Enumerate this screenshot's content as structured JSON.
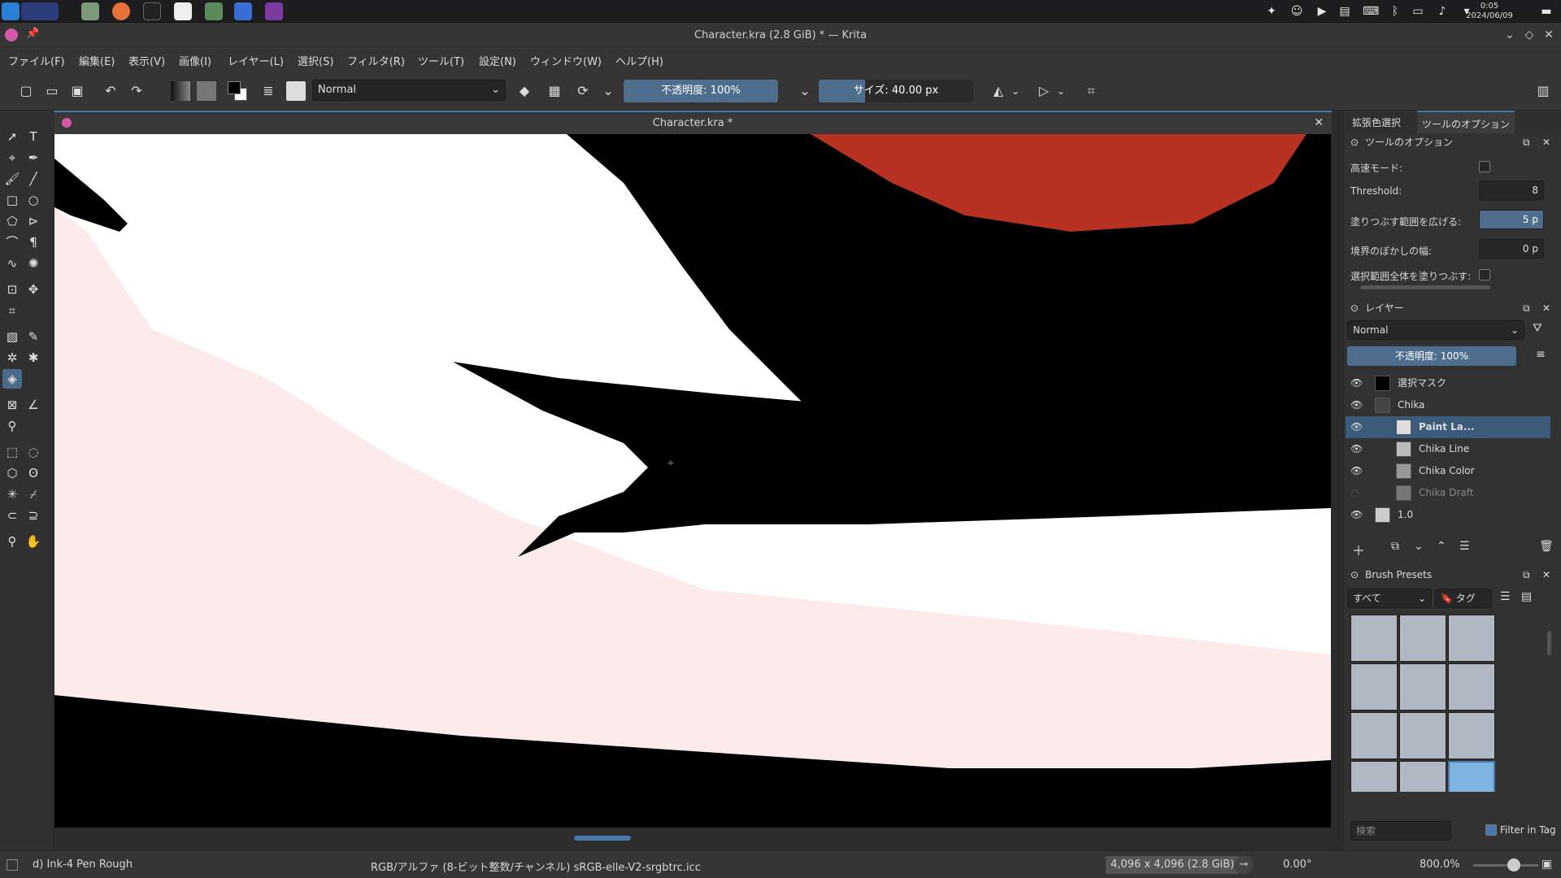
{
  "taskbar": {
    "clock_time": "0:05",
    "clock_date": "2024/06/09"
  },
  "window": {
    "title": "Character.kra (2.8 GiB) * — Krita"
  },
  "menu": [
    "ファイル(F)",
    "編集(E)",
    "表示(V)",
    "画像(I)",
    "レイヤー(L)",
    "選択(S)",
    "フィルタ(R)",
    "ツール(T)",
    "設定(N)",
    "ウィンドウ(W)",
    "ヘルプ(H)"
  ],
  "toolbar": {
    "blend_mode": "Normal",
    "opacity_label": "不透明度: 100%",
    "opacity_fraction": 1.0,
    "size_label": "サイズ: 40.00 px",
    "size_fraction": 0.3
  },
  "document": {
    "tab_title": "Character.kra *"
  },
  "dock": {
    "tabs": [
      "拡張色選択",
      "ツールのオプション"
    ],
    "tool_options": {
      "title": "ツールのオプション",
      "fast_mode_label": "高速モード:",
      "threshold_label": "Threshold:",
      "threshold_value": "8",
      "grow_label": "塗りつぶす範囲を広げる:",
      "grow_value": "5 p",
      "feather_label": "境界のぼかしの幅:",
      "feather_value": "0 p",
      "fill_selection_label": "選択範囲全体を塗りつぶす:"
    },
    "layers": {
      "title": "レイヤー",
      "blend_mode": "Normal",
      "opacity_label": "不透明度: 100%",
      "items": [
        {
          "name": "選択マスク",
          "selected": false
        },
        {
          "name": "Chika",
          "selected": false
        },
        {
          "name": "Paint La...",
          "selected": true
        },
        {
          "name": "Chika Line",
          "selected": false
        },
        {
          "name": "Chika Color",
          "selected": false
        },
        {
          "name": "Chika Draft",
          "selected": false
        },
        {
          "name": "1.0",
          "selected": false
        }
      ]
    },
    "brushes": {
      "title": "Brush Presets",
      "filter": "すべて",
      "tag_label": "タグ",
      "search_placeholder": "検索",
      "filter_in_tag": "Filter in Tag"
    }
  },
  "status": {
    "brush_name": "d) Ink-4 Pen Rough",
    "color_space": "RGB/アルファ (8-ビット整数/チャンネル)  sRGB-elle-V2-srgbtrc.icc",
    "image_size": "4,096 x 4,096 (2.8 GiB)",
    "rotation": "0.00°",
    "zoom": "800.0%"
  },
  "colors": {
    "accent": "#4f6d8d",
    "canvas_pink": "#fdebeb",
    "ink": "#000000",
    "red": "#b83224"
  }
}
